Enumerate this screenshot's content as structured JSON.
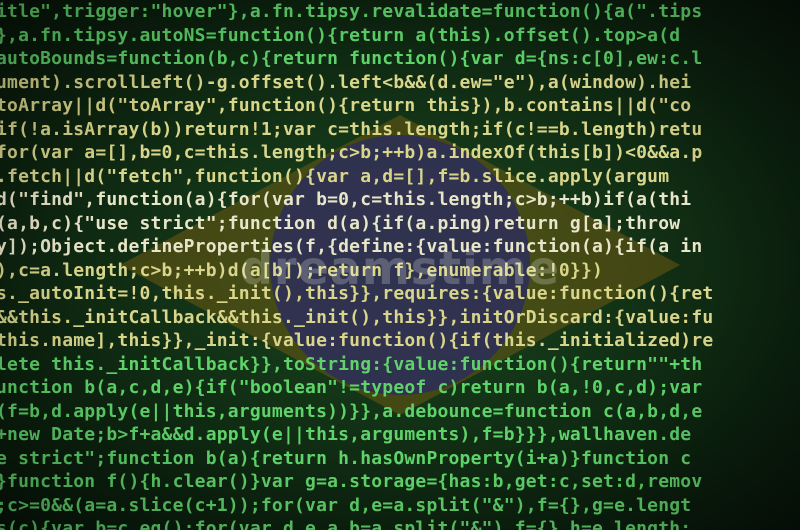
{
  "code_lines": [
    "itle\",trigger:\"hover\"},a.fn.tipsy.revalidate=function(){a(\".tips",
    "},a.fn.tipsy.autoNS=function(){return a(this).offset().top>a(d",
    "autoBounds=function(b,c){return function(){var d={ns:c[0],ew:c.l",
    "ument).scrollLeft()-g.offset().left<b&&(d.ew=\"e\"),a(window).hei",
    "toArray||d(\"toArray\",function(){return this}),b.contains||d(\"co",
    "if(!a.isArray(b))return!1;var c=this.length;if(c!==b.length)retu",
    "for(var a=[],b=0,c=this.length;c>b;++b)a.indexOf(this[b])<0&&a.p",
    ".fetch||d(\"fetch\",function(){var a,d=[],f=b.slice.apply(argum",
    "d(\"find\",function(a){for(var b=0,c=this.length;c>b;++b)if(a(thi",
    "(a,b,c){\"use strict\";function d(a){if(a.ping)return g[a];throw",
    "y]);Object.defineProperties(f,{define:{value:function(a){if(a in",
    "),c=a.length;c>b;++b)d(a[b]);return f},enumerable:!0}})",
    "s._autoInit=!0,this._init(),this}},requires:{value:function(){ret",
    "&&this._initCallback&&this._init(),this}},initOrDiscard:{value:fu",
    "this.name],this}},_init:{value:function(){if(this._initialized)re",
    "lete this._initCallback}},toString:{value:function(){return\"\"+th",
    "unction b(a,c,d,e){if(\"boolean\"!=typeof c)return b(a,!0,c,d);var",
    "(f=b,d.apply(e||this,arguments))}},a.debounce=function c(a,b,d,e",
    "+new Date;b>f+a&&d.apply(e||this,arguments),f=b}}},wallhaven.de",
    "e strict\";function b(a){return h.hasOwnProperty(i+a)}function c",
    "}function f(){h.clear()}var g=a.storage={has:b,get:c,set:d,remov",
    ";c>=0&&(a=a.slice(c+1));for(var d,e=a.split(\"&\"),f={},g=e.lengt",
    "s(c){var b=c.eq();for(var d,e,a,b=a.split(\"&\"),f={},h=e.length;"
  ],
  "watermark_text": "dreamstime"
}
